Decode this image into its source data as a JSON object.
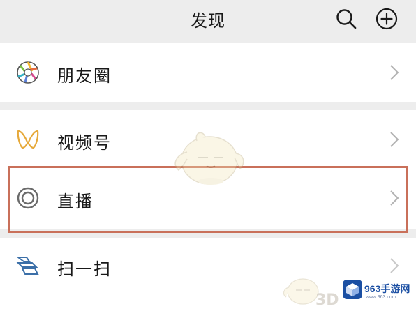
{
  "header": {
    "title": "发现",
    "search_icon": "search-icon",
    "add_icon": "plus-circle-icon"
  },
  "rows": [
    {
      "label": "朋友圈",
      "icon": "moments-aperture-icon"
    },
    {
      "label": "视频号",
      "icon": "channels-butterfly-icon"
    },
    {
      "label": "直播",
      "icon": "live-ring-icon",
      "highlighted": true
    },
    {
      "label": "扫一扫",
      "icon": "scan-icon"
    }
  ],
  "watermark": {
    "site_name": "963手游网",
    "site_url": "www.963.com",
    "mark_text": "3D"
  },
  "colors": {
    "background": "#ededed",
    "row_background": "#ffffff",
    "text": "#191919",
    "chevron": "#b2b2b2",
    "highlight_border": "#c9705a",
    "brand_blue": "#1b4fa3"
  }
}
